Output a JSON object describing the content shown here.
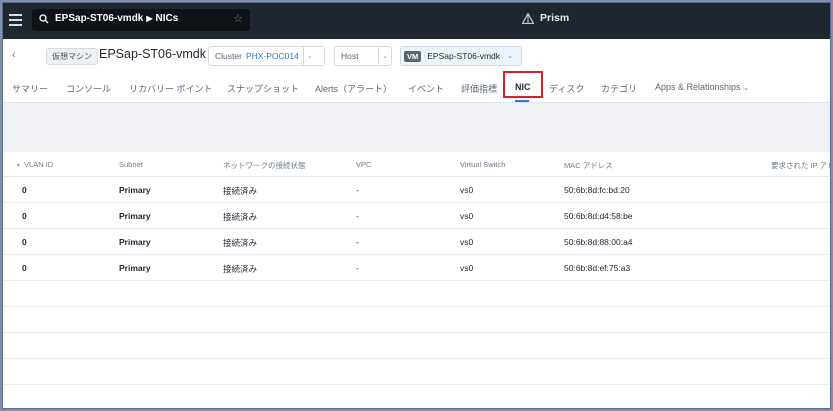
{
  "topbar": {
    "breadcrumb_entity": "EPSap-ST06-vmdk",
    "breadcrumb_page": "NICs",
    "app_name": "Prism"
  },
  "header": {
    "entity_type_badge": "仮想マシン",
    "entity_name": "EPSap-ST06-vmdk",
    "cluster_label": "Cluster",
    "cluster_value": "PHX-POC014",
    "host_label": "Host",
    "vm_tag": "VM",
    "vm_name": "EPSap-ST06-vmdk"
  },
  "tabs": [
    {
      "label": "サマリー"
    },
    {
      "label": "コンソール"
    },
    {
      "label": "リカバリー ポイント"
    },
    {
      "label": "スナップショット"
    },
    {
      "label": "Alerts（アラート）"
    },
    {
      "label": "イベント"
    },
    {
      "label": "評価指標"
    },
    {
      "label": "NIC"
    },
    {
      "label": "ディスク"
    },
    {
      "label": "カテゴリ"
    },
    {
      "label": "Apps & Relationships"
    }
  ],
  "table": {
    "columns": [
      "VLAN ID",
      "Subnet",
      "ネットワークの接続状態",
      "VPC",
      "Virtual Switch",
      "MAC アドレス",
      "要求された IP アド"
    ],
    "rows": [
      {
        "vlan": "0",
        "subnet": "Primary",
        "status": "接続済み",
        "vpc": "-",
        "vswitch": "vs0",
        "mac": "50:6b:8d:fc:bd:20"
      },
      {
        "vlan": "0",
        "subnet": "Primary",
        "status": "接続済み",
        "vpc": "-",
        "vswitch": "vs0",
        "mac": "50:6b:8d:d4:58:be"
      },
      {
        "vlan": "0",
        "subnet": "Primary",
        "status": "接続済み",
        "vpc": "-",
        "vswitch": "vs0",
        "mac": "50:6b:8d:88:00:a4"
      },
      {
        "vlan": "0",
        "subnet": "Primary",
        "status": "接続済み",
        "vpc": "-",
        "vswitch": "vs0",
        "mac": "50:6b:8d:ef:75:a3"
      }
    ]
  },
  "colors": {
    "topbar": "#1f2630",
    "accent": "#2a78d6",
    "highlight": "#d8222a"
  }
}
